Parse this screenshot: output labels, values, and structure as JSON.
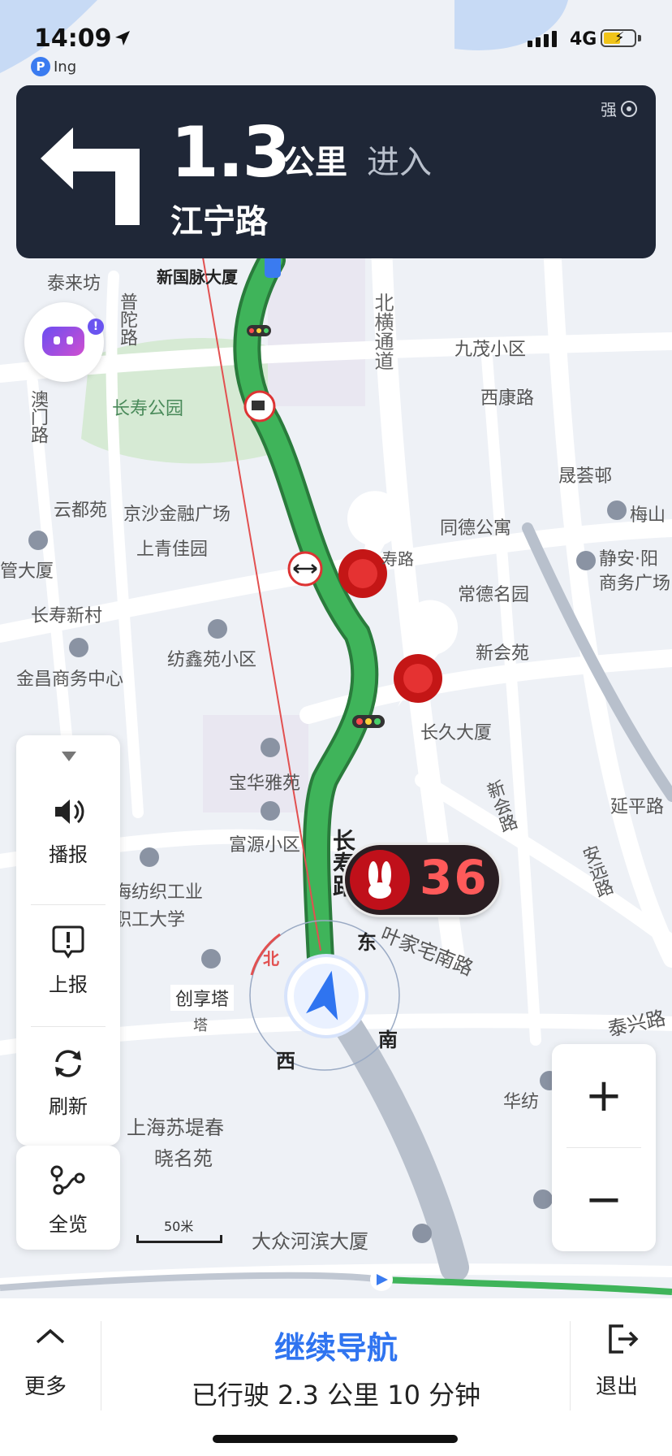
{
  "status_bar": {
    "time": "14:09",
    "network": "4G",
    "ing_label": "Ing",
    "ing_icon_letter": "P"
  },
  "banner": {
    "distance": "1.3",
    "unit": "公里",
    "action": "进入",
    "road": "江宁路",
    "gps_label": "强"
  },
  "map": {
    "labels": [
      {
        "id": "tailaifang",
        "text": "泰来坊"
      },
      {
        "id": "xinguomai",
        "text": "新国脉大厦"
      },
      {
        "id": "jiumao",
        "text": "九茂小区"
      },
      {
        "id": "xikang",
        "text": "西康路"
      },
      {
        "id": "changshou-park",
        "text": "长寿公园"
      },
      {
        "id": "shengcui",
        "text": "晟荟邨"
      },
      {
        "id": "yundu",
        "text": "云都苑"
      },
      {
        "id": "jingsha",
        "text": "京沙金融广场"
      },
      {
        "id": "tongde",
        "text": "同德公寓"
      },
      {
        "id": "meishan",
        "text": "梅山"
      },
      {
        "id": "shangqing",
        "text": "上青佳园"
      },
      {
        "id": "jingan-yang",
        "text": "静安·阳"
      },
      {
        "id": "shangwu",
        "text": "商务广场"
      },
      {
        "id": "guandasha",
        "text": "管大厦"
      },
      {
        "id": "changde",
        "text": "常德名园"
      },
      {
        "id": "changshou-xincun",
        "text": "长寿新村"
      },
      {
        "id": "xinhui",
        "text": "新会苑"
      },
      {
        "id": "jinchang",
        "text": "金昌商务中心"
      },
      {
        "id": "fangxin",
        "text": "纺鑫苑小区"
      },
      {
        "id": "changjiu",
        "text": "长久大厦"
      },
      {
        "id": "baohua",
        "text": "宝华雅苑"
      },
      {
        "id": "yanping",
        "text": "延平路"
      },
      {
        "id": "fuyuan",
        "text": "富源小区"
      },
      {
        "id": "fangzhi",
        "text": "海纺织工业"
      },
      {
        "id": "zhigong",
        "text": "职工大学"
      },
      {
        "id": "chuangxiang",
        "text": "创享塔"
      },
      {
        "id": "ta",
        "text": "塔"
      },
      {
        "id": "huafang",
        "text": "华纺"
      },
      {
        "id": "sutiechun",
        "text": "上海苏堤春"
      },
      {
        "id": "xiaomingyuan",
        "text": "晓名苑"
      },
      {
        "id": "dazhong",
        "text": "大众河滨大厦"
      },
      {
        "id": "putuo-road",
        "text": "普陀路"
      },
      {
        "id": "beiheng",
        "text": "北横通道"
      },
      {
        "id": "aomen-road",
        "text": "澳门路"
      },
      {
        "id": "changshou-road",
        "text": "长寿路"
      },
      {
        "id": "yejiazhai",
        "text": "叶家宅南路"
      },
      {
        "id": "xinhui-road",
        "text": "新会路"
      },
      {
        "id": "anyuan-road",
        "text": "安远路"
      },
      {
        "id": "taixing",
        "text": "泰兴路"
      },
      {
        "id": "lu-fragment",
        "text": "寿路"
      }
    ],
    "compass": {
      "north": "北",
      "east": "东",
      "south": "南",
      "west": "西"
    },
    "scale": "50米"
  },
  "speed": {
    "value": "36"
  },
  "left_panel": [
    {
      "id": "broadcast",
      "label": "播报",
      "icon": "speaker-icon"
    },
    {
      "id": "report",
      "label": "上报",
      "icon": "report-icon"
    },
    {
      "id": "refresh",
      "label": "刷新",
      "icon": "refresh-icon"
    }
  ],
  "overview": {
    "label": "全览",
    "icon": "route-overview-icon"
  },
  "zoom": {
    "in": "+",
    "out": "−"
  },
  "bottom": {
    "more": "更多",
    "continue": "继续导航",
    "trip": "已行驶 2.3 公里 10 分钟",
    "exit": "退出"
  },
  "colors": {
    "route": "#3fb45a",
    "banner": "#1f2737",
    "accent": "#2f74f0",
    "speed": "#ff5a5a"
  }
}
